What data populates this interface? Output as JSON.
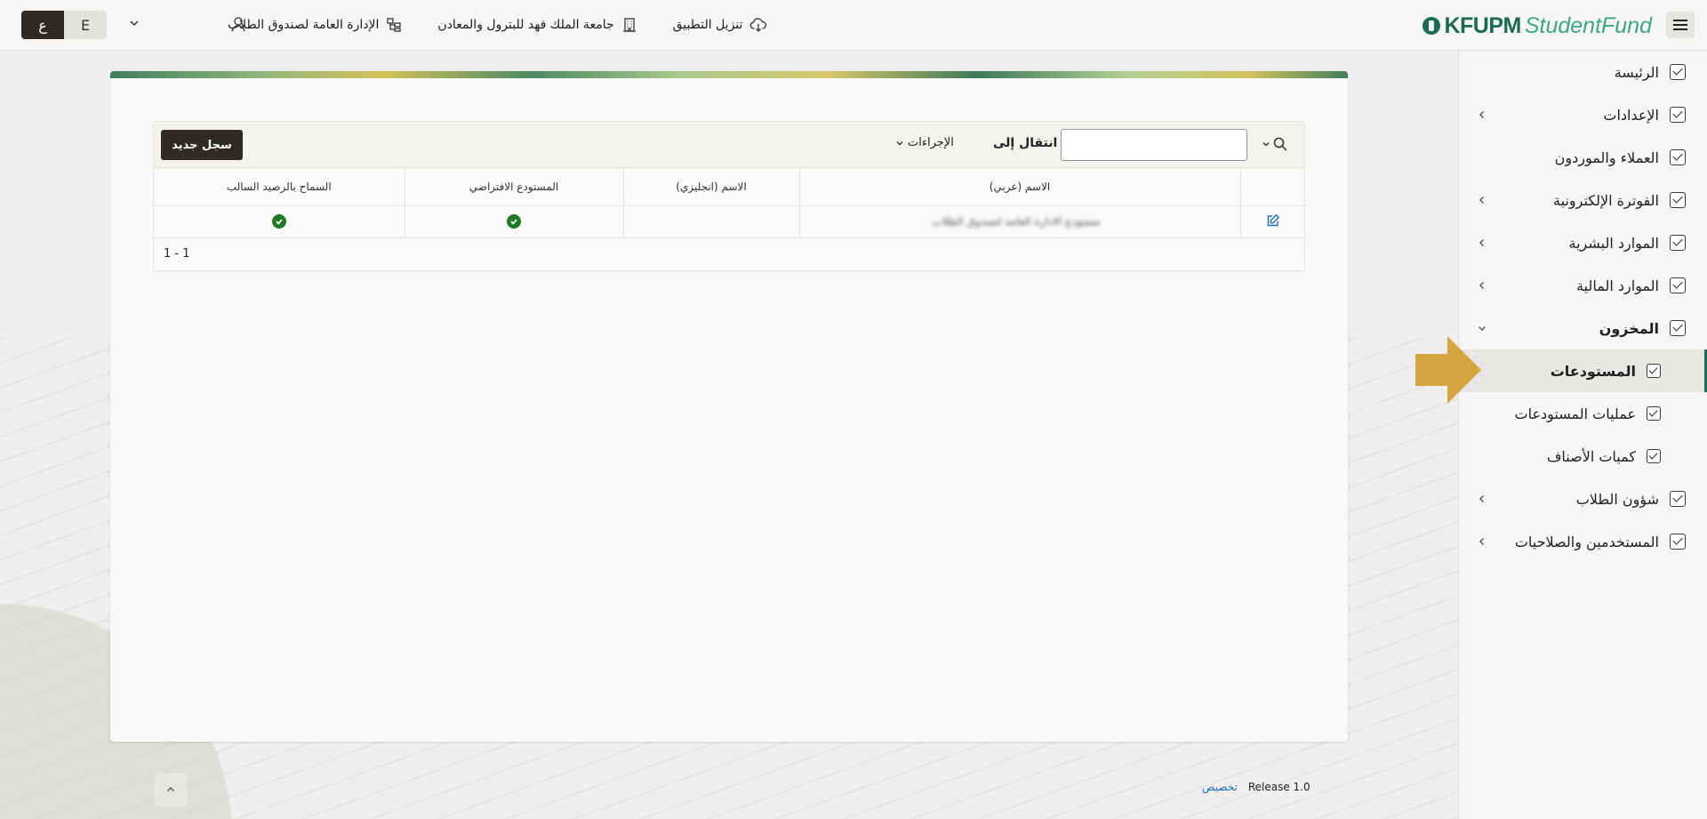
{
  "header": {
    "logo_bold": "KFUPM",
    "logo_light": "StudentFund",
    "nav": [
      {
        "label": "الإدارة العامة لصندوق الطلاب",
        "icon": "org-chart-icon"
      },
      {
        "label": "جامعة الملك فهد للبترول والمعادن",
        "icon": "building-icon"
      },
      {
        "label": "تنزيل التطبيق",
        "icon": "cloud-download-icon"
      }
    ],
    "lang_e": "E",
    "lang_ar": "ع"
  },
  "sidebar": {
    "items": [
      {
        "label": "الرئيسة"
      },
      {
        "label": "الإعدادات"
      },
      {
        "label": "العملاء والموردون"
      },
      {
        "label": "الفوترة الإلكترونية"
      },
      {
        "label": "الموارد البشرية"
      },
      {
        "label": "الموارد المالية"
      },
      {
        "label": "المخزون"
      },
      {
        "label": "المستودعات"
      },
      {
        "label": "عمليات المستودعات"
      },
      {
        "label": "كميات الأصناف"
      },
      {
        "label": "شؤون الطلاب"
      },
      {
        "label": "المستخدمين والصلاحيات"
      }
    ]
  },
  "toolbar": {
    "search_value": "",
    "goto_label": "انتقال إلى",
    "actions_label": "الإجراءات",
    "new_button": "سجل جديد"
  },
  "table": {
    "columns": [
      "السماح بالرصيد السالب",
      "المستودع الافتراضي",
      "الاسم (انجليزي)",
      "الاسم (عربي)"
    ],
    "rows": [
      {
        "allow_negative": "check",
        "default_warehouse": "check",
        "name_en": "",
        "name_ar": "مستودع الادارة العامة لصندوق الطلاب"
      }
    ],
    "pagination": "1 - 1"
  },
  "footer": {
    "customize": "تخصيص",
    "release": "Release 1.0"
  },
  "colors": {
    "brand": "#1c6b57",
    "accent_arrow": "#d4a640",
    "dark_button": "#2e2a25",
    "success": "#1f7a26"
  }
}
